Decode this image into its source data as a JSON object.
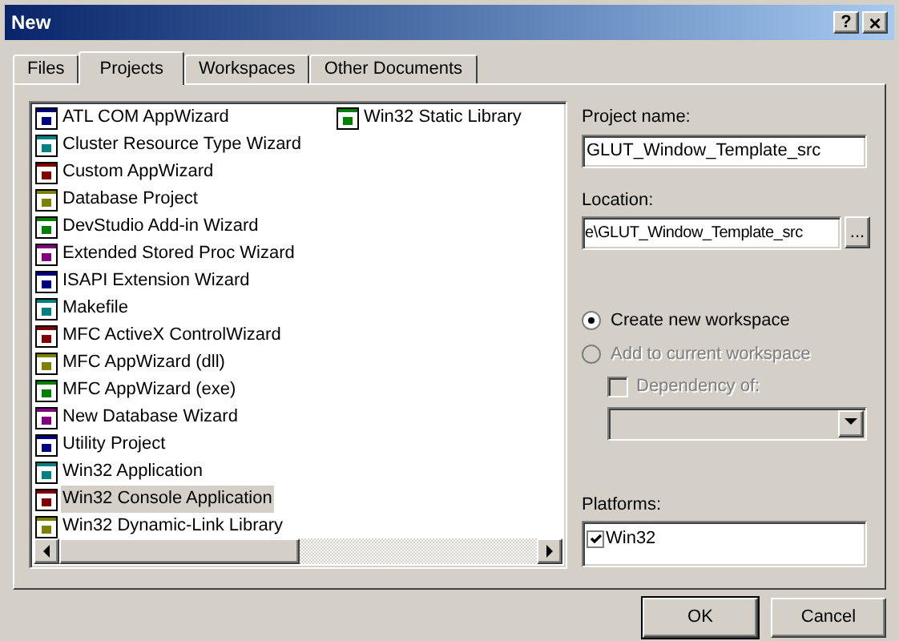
{
  "window": {
    "title": "New",
    "help_button": "?",
    "close_button": "×"
  },
  "tabs": [
    {
      "label": "Files",
      "selected": false
    },
    {
      "label": "Projects",
      "selected": true
    },
    {
      "label": "Workspaces",
      "selected": false
    },
    {
      "label": "Other Documents",
      "selected": false
    }
  ],
  "project_types": [
    {
      "label": "ATL COM AppWizard",
      "selected": false
    },
    {
      "label": "Cluster Resource Type Wizard",
      "selected": false
    },
    {
      "label": "Custom AppWizard",
      "selected": false
    },
    {
      "label": "Database Project",
      "selected": false
    },
    {
      "label": "DevStudio Add-in Wizard",
      "selected": false
    },
    {
      "label": "Extended Stored Proc Wizard",
      "selected": false
    },
    {
      "label": "ISAPI Extension Wizard",
      "selected": false
    },
    {
      "label": "Makefile",
      "selected": false
    },
    {
      "label": "MFC ActiveX ControlWizard",
      "selected": false
    },
    {
      "label": "MFC AppWizard (dll)",
      "selected": false
    },
    {
      "label": "MFC AppWizard (exe)",
      "selected": false
    },
    {
      "label": "New Database Wizard",
      "selected": false
    },
    {
      "label": "Utility Project",
      "selected": false
    },
    {
      "label": "Win32 Application",
      "selected": false
    },
    {
      "label": "Win32 Console Application",
      "selected": true
    },
    {
      "label": "Win32 Dynamic-Link Library",
      "selected": false
    },
    {
      "label": "Win32 Static Library",
      "selected": false
    }
  ],
  "project_name": {
    "label": "Project name:",
    "value": "GLUT_Window_Template_src"
  },
  "location": {
    "label": "Location:",
    "value": "e\\GLUT_Window_Template_src",
    "browse_button": "..."
  },
  "workspace_options": [
    {
      "label": "Create new workspace",
      "selected": true,
      "disabled": false
    },
    {
      "label": "Add to current workspace",
      "selected": false,
      "disabled": true
    }
  ],
  "dependency": {
    "label": "Dependency of:",
    "checked": false,
    "disabled": true
  },
  "platforms": {
    "label": "Platforms:",
    "items": [
      {
        "label": "Win32",
        "checked": true
      }
    ]
  },
  "buttons": [
    {
      "label": "OK"
    },
    {
      "label": "Cancel"
    }
  ]
}
